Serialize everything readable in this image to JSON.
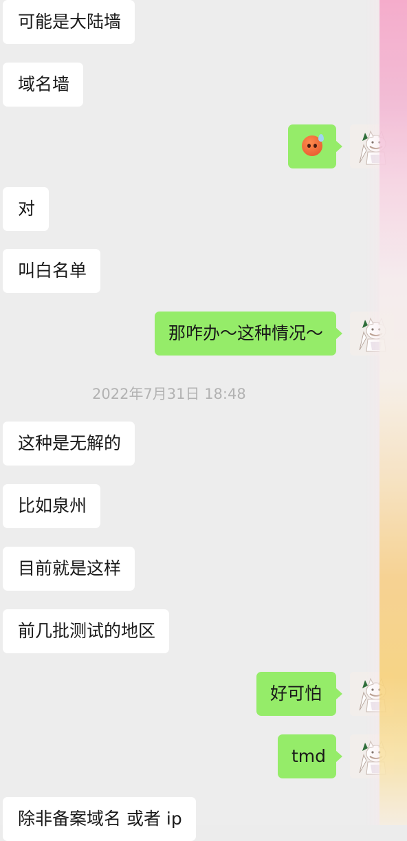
{
  "chat": {
    "timestamp": "2022年7月31日 18:48",
    "messages": [
      {
        "side": "left",
        "text": "可能是大陆墙"
      },
      {
        "side": "left",
        "text": "域名墙"
      },
      {
        "side": "right",
        "emoji": "sweating-face-emoji"
      },
      {
        "side": "left",
        "text": "对"
      },
      {
        "side": "left",
        "text": "叫白名单"
      },
      {
        "side": "right",
        "text": "那咋办～这种情况～"
      },
      {
        "side": "left",
        "text": "这种是无解的"
      },
      {
        "side": "left",
        "text": "比如泉州"
      },
      {
        "side": "left",
        "text": "目前就是这样"
      },
      {
        "side": "left",
        "text": "前几批测试的地区"
      },
      {
        "side": "right",
        "text": "好可怕"
      },
      {
        "side": "right",
        "text": "tmd"
      },
      {
        "side": "left",
        "text": "除非备案域名 或者 ip"
      }
    ]
  },
  "colors": {
    "background": "#ededed",
    "incoming_bubble": "#ffffff",
    "outgoing_bubble": "#95ec69",
    "timestamp_text": "#b2b2b2"
  },
  "icons": {
    "avatar": "cartoon-cat-avatar",
    "emoji": "sweating-face-emoji"
  }
}
